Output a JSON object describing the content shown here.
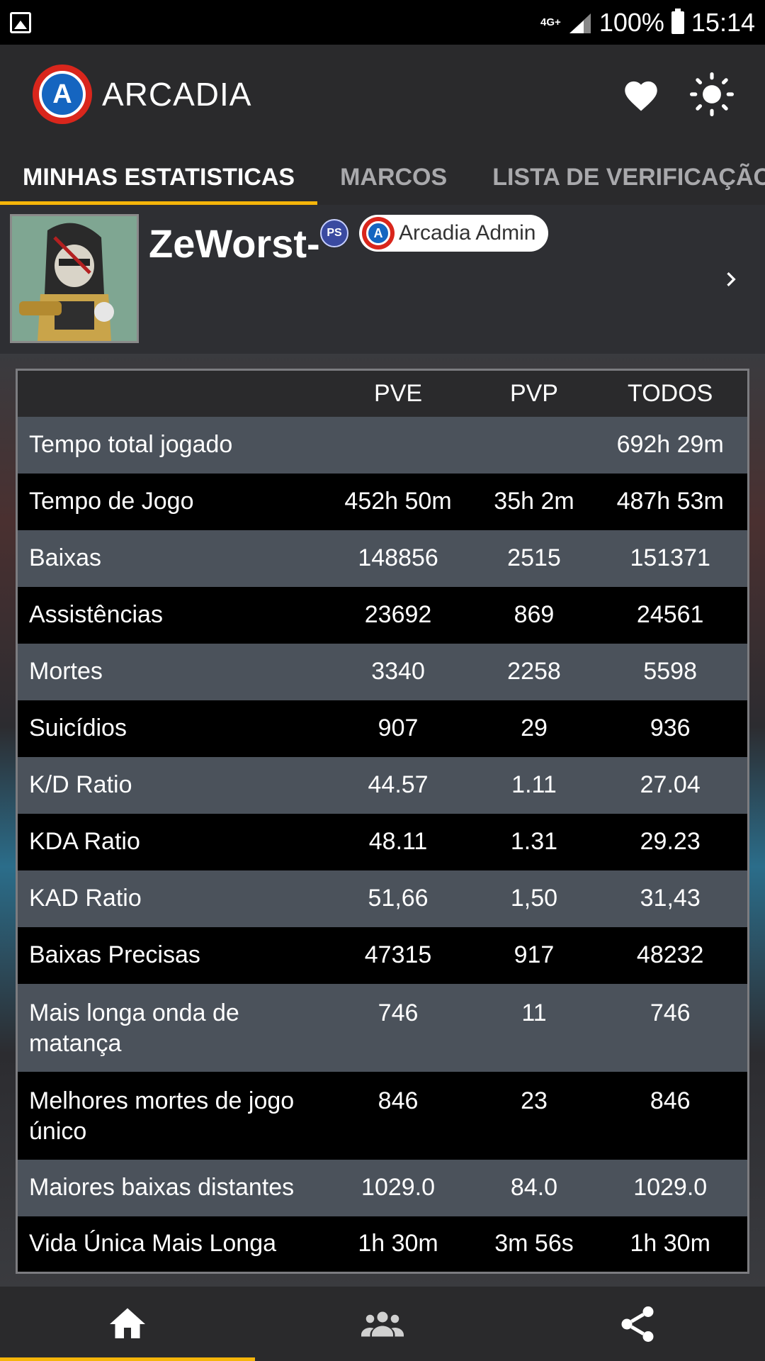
{
  "statusbar": {
    "network": "4G+",
    "battery": "100%",
    "time": "15:14"
  },
  "appbar": {
    "title": "ARCADIA",
    "logo_letter": "A",
    "icons": [
      "heart-icon",
      "brightness-icon"
    ]
  },
  "tabs": [
    {
      "label": "MINHAS ESTATISTICAS",
      "active": true
    },
    {
      "label": "MARCOS",
      "active": false
    },
    {
      "label": "LISTA DE VERIFICAÇÃO",
      "active": false
    }
  ],
  "profile": {
    "username": "ZeWorst-",
    "platform_badge": "PS",
    "admin_badge": "Arcadia Admin"
  },
  "stats": {
    "headers": [
      "",
      "PVE",
      "PVP",
      "TODOS"
    ],
    "rows": [
      {
        "label": "Tempo total jogado",
        "pve": "",
        "pvp": "",
        "todos": "692h 29m"
      },
      {
        "label": "Tempo de Jogo",
        "pve": "452h 50m",
        "pvp": "35h 2m",
        "todos": "487h 53m"
      },
      {
        "label": "Baixas",
        "pve": "148856",
        "pvp": "2515",
        "todos": "151371"
      },
      {
        "label": "Assistências",
        "pve": "23692",
        "pvp": "869",
        "todos": "24561"
      },
      {
        "label": "Mortes",
        "pve": "3340",
        "pvp": "2258",
        "todos": "5598"
      },
      {
        "label": "Suicídios",
        "pve": "907",
        "pvp": "29",
        "todos": "936"
      },
      {
        "label": "K/D Ratio",
        "pve": "44.57",
        "pvp": "1.11",
        "todos": "27.04"
      },
      {
        "label": "KDA Ratio",
        "pve": "48.11",
        "pvp": "1.31",
        "todos": "29.23"
      },
      {
        "label": "KAD Ratio",
        "pve": "51,66",
        "pvp": "1,50",
        "todos": "31,43"
      },
      {
        "label": "Baixas Precisas",
        "pve": "47315",
        "pvp": "917",
        "todos": "48232"
      },
      {
        "label": "Mais longa onda de matança",
        "pve": "746",
        "pvp": "11",
        "todos": "746"
      },
      {
        "label": "Melhores mortes de jogo único",
        "pve": "846",
        "pvp": "23",
        "todos": "846"
      },
      {
        "label": "Maiores baixas distantes",
        "pve": "1029.0",
        "pvp": "84.0",
        "todos": "1029.0"
      },
      {
        "label": "Vida Única Mais Longa",
        "pve": "1h 30m",
        "pvp": "3m 56s",
        "todos": "1h 30m"
      }
    ]
  },
  "bottomnav": [
    {
      "icon": "home-icon",
      "active": true
    },
    {
      "icon": "group-icon",
      "active": false
    },
    {
      "icon": "share-icon",
      "active": false
    }
  ],
  "colors": {
    "accent": "#f5b50a",
    "background": "#2a2a2c",
    "row_light": "#4b525b",
    "row_dark": "#000000"
  }
}
